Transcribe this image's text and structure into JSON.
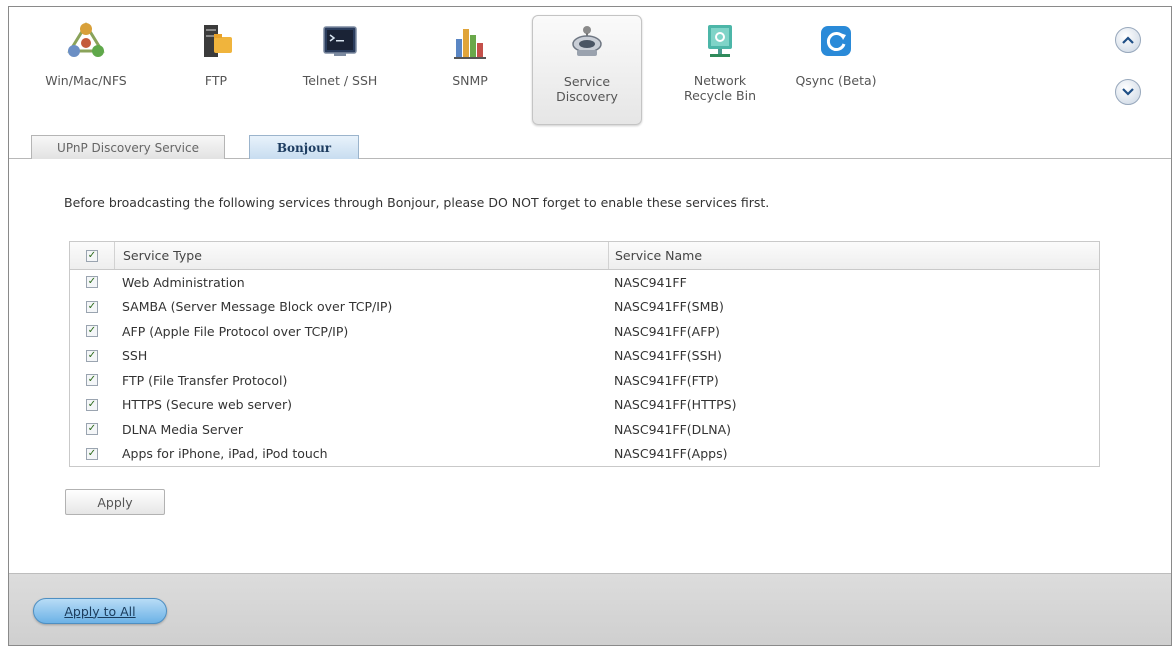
{
  "toolbar": {
    "items": [
      {
        "label": "Win/Mac/NFS",
        "icon": "network-share-icon"
      },
      {
        "label": "FTP",
        "icon": "ftp-server-icon"
      },
      {
        "label": "Telnet / SSH",
        "icon": "terminal-icon"
      },
      {
        "label": "SNMP",
        "icon": "snmp-chart-icon"
      },
      {
        "label": "Service Discovery",
        "icon": "service-discovery-icon"
      },
      {
        "label": "Network Recycle Bin",
        "icon": "recycle-bin-icon"
      },
      {
        "label": "Qsync (Beta)",
        "icon": "qsync-icon"
      }
    ],
    "active_index": 4,
    "scroll_up_icon": "chevron-up-icon",
    "scroll_down_icon": "chevron-down-icon"
  },
  "tabs": [
    {
      "label": "UPnP Discovery Service",
      "active": false
    },
    {
      "label": "Bonjour",
      "active": true
    }
  ],
  "notice": "Before broadcasting the following services through Bonjour, please DO NOT forget to enable these services first.",
  "table": {
    "headers": [
      "Service Type",
      "Service Name"
    ],
    "header_checked": true,
    "rows": [
      {
        "type": "Web Administration",
        "name": "NASC941FF",
        "checked": true
      },
      {
        "type": "SAMBA (Server Message Block over TCP/IP)",
        "name": "NASC941FF(SMB)",
        "checked": true
      },
      {
        "type": "AFP (Apple File Protocol over TCP/IP)",
        "name": "NASC941FF(AFP)",
        "checked": true
      },
      {
        "type": "SSH",
        "name": "NASC941FF(SSH)",
        "checked": true
      },
      {
        "type": "FTP (File Transfer Protocol)",
        "name": "NASC941FF(FTP)",
        "checked": true
      },
      {
        "type": "HTTPS (Secure web server)",
        "name": "NASC941FF(HTTPS)",
        "checked": true
      },
      {
        "type": "DLNA Media Server",
        "name": "NASC941FF(DLNA)",
        "checked": true
      },
      {
        "type": "Apps for iPhone, iPad, iPod touch",
        "name": "NASC941FF(Apps)",
        "checked": true
      }
    ]
  },
  "buttons": {
    "apply": "Apply",
    "apply_all": "Apply to All"
  },
  "colors": {
    "accent_blue": "#6cb2e6",
    "tab_active": "#c8ddf0",
    "check_green": "#2c6a1a"
  }
}
